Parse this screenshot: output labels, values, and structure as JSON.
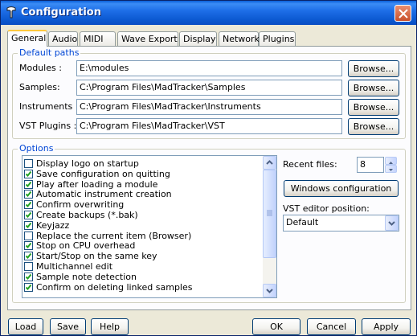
{
  "window": {
    "title": "Configuration"
  },
  "tabs": [
    {
      "label": "General",
      "active": true
    },
    {
      "label": "Audio"
    },
    {
      "label": "MIDI"
    },
    {
      "label": "Wave Export"
    },
    {
      "label": "Display"
    },
    {
      "label": "Network"
    },
    {
      "label": "Plugins"
    }
  ],
  "default_paths": {
    "legend": "Default paths",
    "rows": [
      {
        "label": "Modules :",
        "value": "E:\\modules",
        "button": "Browse..."
      },
      {
        "label": "Samples:",
        "value": "C:\\Program Files\\MadTracker\\Samples",
        "button": "Browse..."
      },
      {
        "label": "Instruments :",
        "value": "C:\\Program Files\\MadTracker\\Instruments",
        "button": "Browse..."
      },
      {
        "label": "VST Plugins :",
        "value": "C:\\Program Files\\MadTracker\\VST",
        "button": "Browse..."
      }
    ]
  },
  "options": {
    "legend": "Options",
    "items": [
      {
        "label": "Display logo on startup",
        "checked": false
      },
      {
        "label": "Save configuration on quitting",
        "checked": true
      },
      {
        "label": "Play after loading a module",
        "checked": true
      },
      {
        "label": "Automatic instrument creation",
        "checked": true
      },
      {
        "label": "Confirm overwriting",
        "checked": true
      },
      {
        "label": "Create backups (*.bak)",
        "checked": true
      },
      {
        "label": "Keyjazz",
        "checked": true
      },
      {
        "label": "Replace the current item (Browser)",
        "checked": false
      },
      {
        "label": "Stop on CPU overhead",
        "checked": true
      },
      {
        "label": "Start/Stop on the same key",
        "checked": true
      },
      {
        "label": "Multichannel edit",
        "checked": false
      },
      {
        "label": "Sample note detection",
        "checked": true
      },
      {
        "label": "Confirm on deleting linked samples",
        "checked": true
      }
    ],
    "recent_files_label": "Recent files:",
    "recent_files_value": "8",
    "windows_config_button": "Windows configuration",
    "vst_editor_label": "VST editor position:",
    "vst_editor_value": "Default"
  },
  "footer": {
    "load": "Load",
    "save": "Save",
    "help": "Help",
    "ok": "OK",
    "cancel": "Cancel",
    "apply": "Apply"
  }
}
